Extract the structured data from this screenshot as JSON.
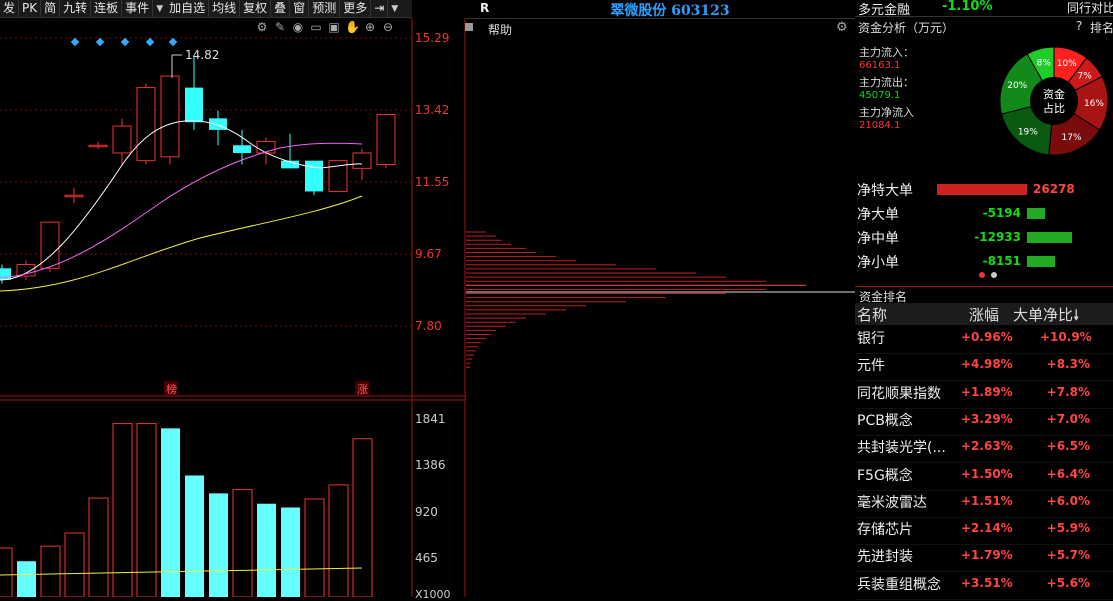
{
  "toolbar": {
    "items": [
      "发",
      "PK",
      "简",
      "九转",
      "连板",
      "事件",
      "加自选",
      "均线",
      "复权",
      "叠",
      "窗",
      "预测",
      "更多"
    ]
  },
  "kline": {
    "y_axis_labels": [
      "15.29",
      "13.42",
      "11.55",
      "9.67",
      "7.80"
    ],
    "high_marker": "14.82",
    "tag_bang": "榜",
    "tag_zhang": "涨",
    "colors": {
      "up": "#e33",
      "down": "#3ff",
      "ma5": "#fff",
      "ma10": "#e6e",
      "ma30": "#ee4"
    }
  },
  "chart_data": [
    {
      "type": "candlestick",
      "title": "",
      "y_labels": [
        "15.29",
        "13.42",
        "11.55",
        "9.67",
        "7.80"
      ],
      "ylim": [
        7.8,
        15.29
      ],
      "candles": [
        {
          "o": 9.3,
          "c": 9.0,
          "h": 9.4,
          "l": 8.9,
          "up": false
        },
        {
          "o": 9.1,
          "c": 9.4,
          "h": 9.5,
          "l": 9.0,
          "up": true
        },
        {
          "o": 9.3,
          "c": 10.5,
          "h": 10.5,
          "l": 9.2,
          "up": true
        },
        {
          "o": 11.2,
          "c": 11.2,
          "h": 11.4,
          "l": 11.0,
          "up": true
        },
        {
          "o": 12.5,
          "c": 12.5,
          "h": 12.6,
          "l": 12.4,
          "up": true
        },
        {
          "o": 12.3,
          "c": 13.0,
          "h": 13.2,
          "l": 12.0,
          "up": true
        },
        {
          "o": 12.1,
          "c": 14.0,
          "h": 14.1,
          "l": 12.0,
          "up": true
        },
        {
          "o": 12.2,
          "c": 14.3,
          "h": 14.3,
          "l": 12.0,
          "up": true
        },
        {
          "o": 14.0,
          "c": 13.1,
          "h": 14.82,
          "l": 12.9,
          "up": false
        },
        {
          "o": 13.2,
          "c": 12.9,
          "h": 13.4,
          "l": 12.5,
          "up": false
        },
        {
          "o": 12.5,
          "c": 12.3,
          "h": 12.9,
          "l": 12.0,
          "up": false
        },
        {
          "o": 12.3,
          "c": 12.6,
          "h": 12.7,
          "l": 12.0,
          "up": true
        },
        {
          "o": 12.1,
          "c": 11.9,
          "h": 12.8,
          "l": 11.9,
          "up": false
        },
        {
          "o": 12.1,
          "c": 11.3,
          "h": 12.1,
          "l": 11.2,
          "up": false
        },
        {
          "o": 11.3,
          "c": 12.1,
          "h": 12.1,
          "l": 11.3,
          "up": true
        },
        {
          "o": 11.9,
          "c": 12.3,
          "h": 12.4,
          "l": 11.6,
          "up": true
        },
        {
          "o": 12.0,
          "c": 13.3,
          "h": 13.3,
          "l": 11.9,
          "up": true
        }
      ]
    },
    {
      "type": "bar",
      "title": "",
      "y_labels": [
        "1841",
        "1386",
        "920",
        "465"
      ],
      "ylim": [
        0,
        1900
      ],
      "values": [
        520,
        380,
        540,
        680,
        1050,
        1841,
        1841,
        1790,
        1290,
        1100,
        1140,
        990,
        950,
        1040,
        1190,
        1680
      ]
    }
  ],
  "volume": {
    "y_axis_labels": [
      "1841",
      "1386",
      "920",
      "465"
    ],
    "cut_label": "X1000"
  },
  "middle": {
    "r_label": "R",
    "stock_title": "翠微股份 603123",
    "help": "帮助"
  },
  "right": {
    "top_tab": "多元金融",
    "top_pct": "-1.10%",
    "top_right": "同行对比",
    "fund_title": "资金分析（万元）",
    "fund_help": "?",
    "fund_rank": "排名",
    "inflow_label": "主力流入：",
    "inflow_value": "66163.1",
    "outflow_label": "主力流出：",
    "outflow_value": "45079.1",
    "net_label": "主力净流入",
    "net_value": "21084.1",
    "pie_center_1": "资金",
    "pie_center_2": "占比",
    "pie": [
      {
        "label": "10%",
        "value": 10,
        "color": "#ff2020"
      },
      {
        "label": "7%",
        "value": 7,
        "color": "#cc1a1a"
      },
      {
        "label": "16%",
        "value": 16,
        "color": "#a81414"
      },
      {
        "label": "17%",
        "value": 17,
        "color": "#7a0c0c"
      },
      {
        "label": "19%",
        "value": 19,
        "color": "#0b5a12"
      },
      {
        "label": "20%",
        "value": 20,
        "color": "#118a1a"
      },
      {
        "label": "8%",
        "value": 8,
        "color": "#1fcc2a"
      }
    ],
    "net_rows": [
      {
        "label": "净特大单",
        "value": "26278",
        "bar": 0.9,
        "color": "#c22"
      },
      {
        "label": "净大单",
        "value": "-5194",
        "bar": 0.18,
        "color": "#2a2"
      },
      {
        "label": "净中单",
        "value": "-12933",
        "bar": 0.45,
        "color": "#2a2"
      },
      {
        "label": "净小单",
        "value": "-8151",
        "bar": 0.28,
        "color": "#2a2"
      }
    ],
    "ranking_title": "资金排名",
    "rank_headers": [
      "名称",
      "涨幅",
      "大单净比"
    ],
    "ranks": [
      {
        "name": "银行",
        "pct": "+0.96%",
        "big": "+10.9%"
      },
      {
        "name": "元件",
        "pct": "+4.98%",
        "big": "+8.3%"
      },
      {
        "name": "同花顺果指数",
        "pct": "+1.89%",
        "big": "+7.8%"
      },
      {
        "name": "PCB概念",
        "pct": "+3.29%",
        "big": "+7.0%"
      },
      {
        "name": "共封装光学(...",
        "pct": "+2.63%",
        "big": "+6.5%"
      },
      {
        "name": "F5G概念",
        "pct": "+1.50%",
        "big": "+6.4%"
      },
      {
        "name": "毫米波雷达",
        "pct": "+1.51%",
        "big": "+6.0%"
      },
      {
        "name": "存储芯片",
        "pct": "+2.14%",
        "big": "+5.9%"
      },
      {
        "name": "先进封装",
        "pct": "+1.79%",
        "big": "+5.7%"
      },
      {
        "name": "兵装重组概念",
        "pct": "+3.51%",
        "big": "+5.6%"
      }
    ]
  }
}
